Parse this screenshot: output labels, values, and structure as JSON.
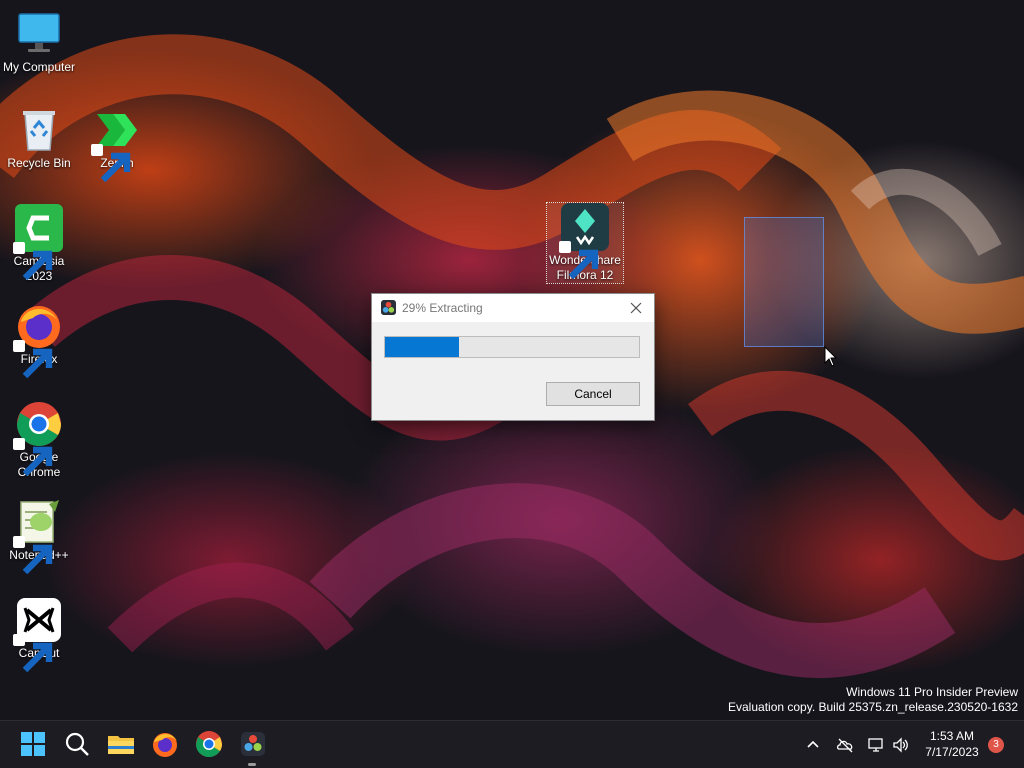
{
  "desktop": {
    "icons": [
      {
        "label": "My Computer",
        "icon": "computer-icon",
        "shortcut": false
      },
      {
        "label": "Recycle Bin",
        "icon": "recycle-bin-icon",
        "shortcut": false
      },
      {
        "label": "Zenith",
        "icon": "zenith-icon",
        "shortcut": true
      },
      {
        "label": "Camtasia 2023",
        "icon": "camtasia-icon",
        "shortcut": true
      },
      {
        "label": "Wondershare Filmora 12",
        "icon": "filmora-icon",
        "shortcut": true,
        "selected": true
      },
      {
        "label": "Firefox",
        "icon": "firefox-icon",
        "shortcut": true
      },
      {
        "label": "Google Chrome",
        "icon": "chrome-icon",
        "shortcut": true
      },
      {
        "label": "Notepad++",
        "icon": "notepadpp-icon",
        "shortcut": true
      },
      {
        "label": "CapCut",
        "icon": "capcut-icon",
        "shortcut": true
      }
    ],
    "watermark": {
      "line1": "Windows 11 Pro Insider Preview",
      "line2": "Evaluation copy. Build 25375.zn_release.230520-1632"
    }
  },
  "dialog": {
    "title": "29% Extracting",
    "progress_percent": 29,
    "cancel_label": "Cancel",
    "app_icon": "davinci-resolve-icon"
  },
  "taskbar": {
    "pinned": [
      "start-icon",
      "search-icon",
      "file-explorer-icon",
      "firefox-icon",
      "chrome-icon",
      "davinci-resolve-icon"
    ],
    "active_app": "davinci-resolve-icon",
    "tray": [
      "chevron-up-icon",
      "cloud-offline-icon",
      "network-icon",
      "volume-icon"
    ],
    "time": "1:53 AM",
    "date": "7/17/2023",
    "notification_count": "3"
  },
  "colors": {
    "accent": "#0678d4",
    "taskbar": "#1c1c22",
    "badge": "#e0554a"
  }
}
